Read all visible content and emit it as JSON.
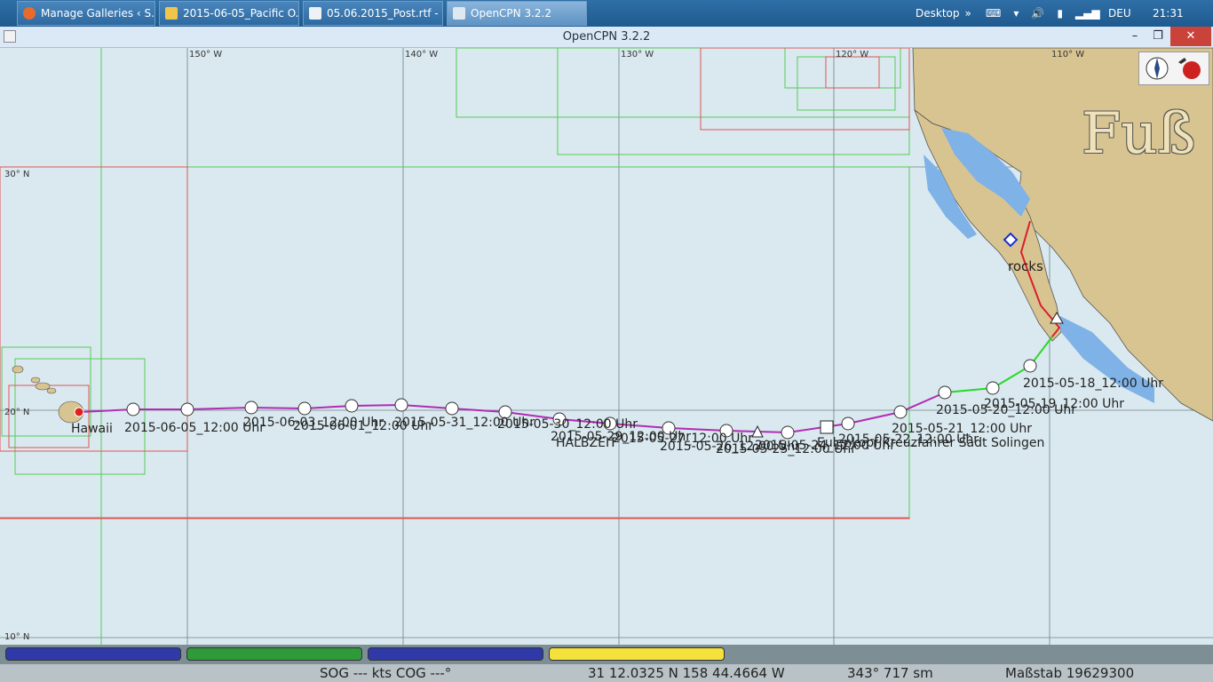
{
  "taskbar": {
    "tasks": [
      {
        "label": "Manage Galleries ‹ S..."
      },
      {
        "label": "2015-06-05_Pacific O..."
      },
      {
        "label": "05.06.2015_Post.rtf - ..."
      },
      {
        "label": "OpenCPN 3.2.2"
      }
    ],
    "desktop_label": "Desktop",
    "desktop_arrow": "»",
    "language": "DEU",
    "time": "21:31"
  },
  "window": {
    "title": "OpenCPN 3.2.2",
    "minimize": "–",
    "maximize": "❐",
    "close": "✕"
  },
  "chart": {
    "longitude_labels": [
      "150° W",
      "140° W",
      "130° W",
      "120° W",
      "110° W"
    ],
    "latitude_labels": [
      "30° N",
      "20° N",
      "10° N"
    ],
    "overlay_text": "Fuß",
    "track_labels": [
      "2015-05-18_12:00 Uhr",
      "2015-05-19_12:00 Uhr",
      "2015-05-20_12:00 Uhr",
      "2015-05-21_12:00 Uhr",
      "2015-05-22_12:00 Uhr",
      "Eulenkopf Kreuzfahrer Sadt Solingen",
      "2015-06-03_12:00 Uhr",
      "2015-05-31_12:00 Uhr",
      "2015-05-30_12:00 Uhr",
      "2015-05-29_12:00 Uhr",
      "2015-05-27_12:00 Uhr",
      "2015-05-26_12:00 Uhr",
      "2015-05-25_12:00 Uhr",
      "2015-05-24_12:00 Uhr",
      "HALBZEIT",
      "2015-06-01_12:00 Uhr",
      "Hawaii",
      "2015-06-05_12:00 Uhr",
      "rocks"
    ]
  },
  "toolbar": {
    "tools": [
      {
        "name": "zoom-in-button",
        "icon": "zoom-in-icon"
      },
      {
        "name": "zoom-out-button",
        "icon": "zoom-out-icon"
      },
      {
        "name": "chart-quilting-button",
        "icon": "funnel-icon"
      },
      {
        "name": "follow-button",
        "icon": "ship-icon"
      },
      {
        "name": "route-button",
        "icon": "route-icon"
      },
      {
        "name": "boat-button",
        "icon": "boat-icon"
      },
      {
        "name": "settings-button",
        "icon": "wrench-icon"
      },
      {
        "name": "text-button",
        "icon": "text-add-icon"
      },
      {
        "name": "current-button",
        "icon": "current-icon"
      },
      {
        "name": "tide-button",
        "icon": "tide-icon"
      },
      {
        "name": "tide-height-button",
        "icon": "tide-height-icon"
      },
      {
        "name": "print-button",
        "icon": "printer-icon"
      },
      {
        "name": "route-manager-button",
        "icon": "route-manager-icon"
      },
      {
        "name": "track-button",
        "icon": "track-icon"
      },
      {
        "name": "color-scheme-button",
        "icon": "sunset-icon"
      },
      {
        "name": "mob-button",
        "icon": "lifebuoy-icon"
      },
      {
        "name": "help-button",
        "icon": "help-icon"
      },
      {
        "name": "about-button",
        "icon": "about-icon"
      }
    ]
  },
  "piano": {
    "keys": [
      {
        "color": "#2f3aa8"
      },
      {
        "color": "#2f9a3a"
      },
      {
        "color": "#2f3aa8"
      },
      {
        "color": "#f4e23a"
      }
    ]
  },
  "status": {
    "sog": "SOG --- kts  COG ---°",
    "position": "31 12.0325 N   158 44.4664 W",
    "bearing": "343°  717 sm",
    "scale": "Maßstab 19629300"
  },
  "colors": {
    "land": "#d8c491",
    "shallow": "#7fb2e6",
    "sea": "#d9e9ef",
    "track_purple": "#b02db3",
    "track_green": "#27d927",
    "track_red": "#d91f2a"
  }
}
